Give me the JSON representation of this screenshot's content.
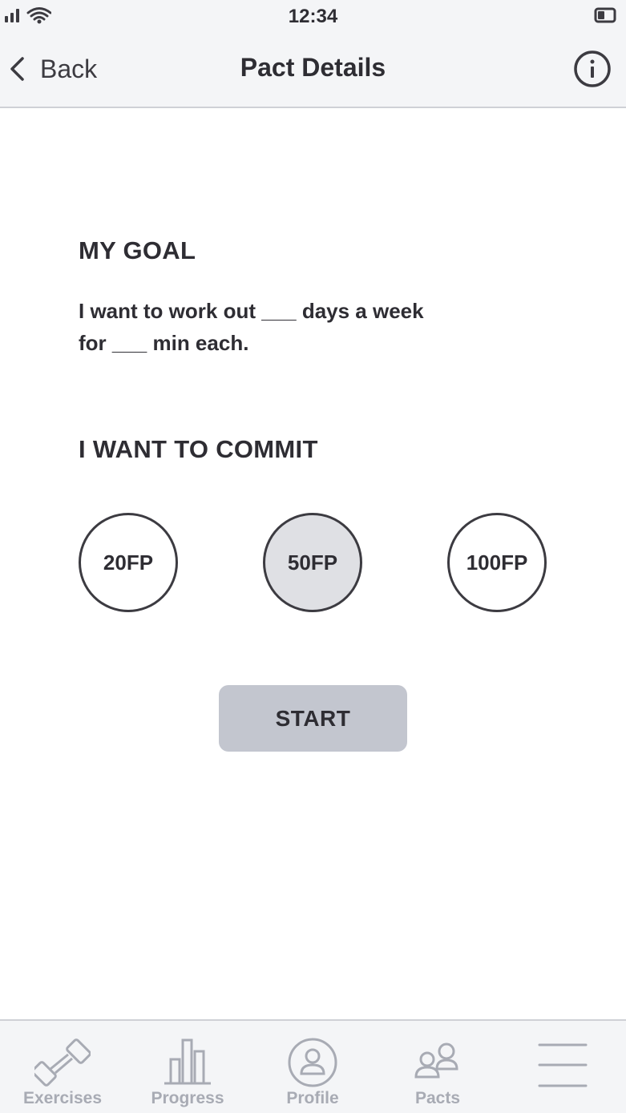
{
  "status_bar": {
    "time": "12:34",
    "icons": [
      "signal-icon",
      "wifi-icon",
      "battery-icon"
    ]
  },
  "nav": {
    "back_label": "Back",
    "title": "Pact Details",
    "info_icon": "info-icon"
  },
  "goal": {
    "heading": "MY GOAL",
    "line1": "I want to work out ___ days a week",
    "line2": "for ___ min each."
  },
  "commit": {
    "heading": "I WANT TO COMMIT",
    "options": [
      "20FP",
      "50FP",
      "100FP"
    ],
    "selected": "50FP"
  },
  "start_label": "START",
  "tabs": [
    {
      "label": "Exercises",
      "icon": "dumbbell-icon"
    },
    {
      "label": "Progress",
      "icon": "bar-chart-icon"
    },
    {
      "label": "Profile",
      "icon": "user-icon"
    },
    {
      "label": "Pacts",
      "icon": "group-icon"
    },
    {
      "label": "",
      "icon": "menu-icon"
    }
  ],
  "colors": {
    "text": "#2e2d33",
    "bar_background": "#f4f5f7",
    "selected_option": "#dfe0e4",
    "start_button": "#c3c6cf",
    "tab_inactive": "#a8abb4"
  }
}
